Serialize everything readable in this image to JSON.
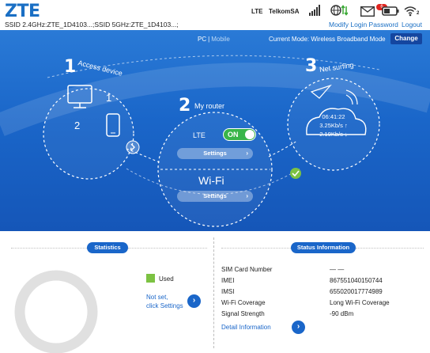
{
  "header": {
    "logo": "ZTE",
    "ssid_line": "SSID 2.4GHz:ZTE_1D4103...;SSID 5GHz:ZTE_1D4103...;",
    "network_type": "LTE",
    "operator": "TelkomSA",
    "unread_messages": "6",
    "wifi_users": "2",
    "modify_password_link": "Modify Login Password",
    "logout_link": "Logout",
    "icons": [
      "signal-icon",
      "globe-data-icon",
      "mail-icon",
      "battery-icon",
      "wifi-icon"
    ]
  },
  "topbar": {
    "pc": "PC",
    "separator": "|",
    "mobile": "Mobile",
    "current_mode": "Current Mode: Wireless Broadband Mode",
    "change_button": "Change"
  },
  "steps": {
    "access": {
      "number": "1",
      "label": "Access device",
      "devices": [
        "1",
        "2"
      ]
    },
    "router": {
      "number": "2",
      "label": "My router",
      "lte_label": "LTE",
      "toggle": "ON",
      "settings_label": "Settings",
      "wifi_label": "Wi-Fi",
      "wifi_settings_label": "Settings"
    },
    "net": {
      "number": "3",
      "label": "Net surfing",
      "time": "06:41:22",
      "upload": "3.25Kb/s ↑",
      "download": "2.19Kb/s ↓"
    }
  },
  "statistics": {
    "title": "Statistics",
    "legend_used": "Used",
    "not_set": "Not set,",
    "click_settings": "click Settings",
    "used_fraction": 0
  },
  "status": {
    "title": "Status Information",
    "rows": [
      {
        "label": "SIM Card Number",
        "value": "— —"
      },
      {
        "label": "IMEI",
        "value": "867551040150744"
      },
      {
        "label": "IMSI",
        "value": "655020017774989"
      },
      {
        "label": "Wi-Fi Coverage",
        "value": "Long Wi-Fi Coverage"
      },
      {
        "label": "Signal Strength",
        "value": "-90 dBm"
      }
    ],
    "detail_link": "Detail Information"
  },
  "colors": {
    "brand_blue": "#1a6fc4",
    "banner_blue": "#1a66c9",
    "toggle_green": "#39b54a",
    "used_green": "#7cc242",
    "badge_red": "#e0241f"
  }
}
